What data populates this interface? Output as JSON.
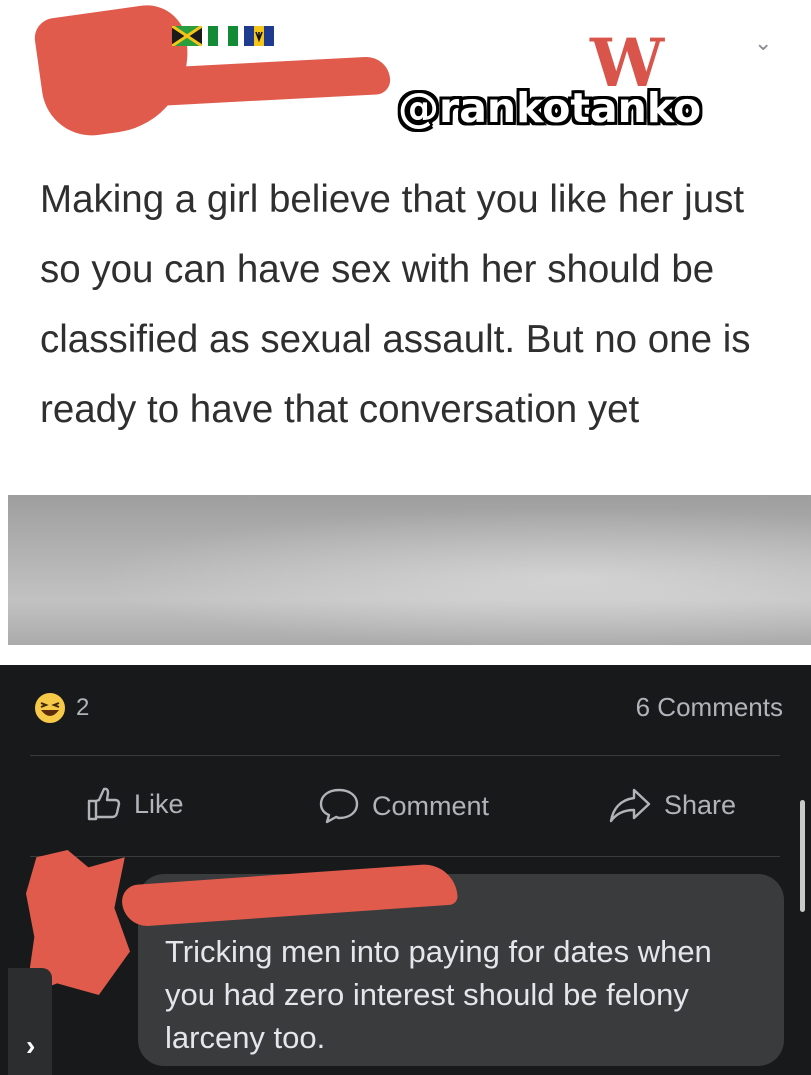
{
  "watermark": "@rankotanko",
  "logo_text": "W",
  "post": {
    "text": "Making a girl believe that you like her just so you can have sex with her should be classified as sexual assault. But no one is ready to have that conversation yet"
  },
  "reactions": {
    "emoji": "laughing-emoji-icon",
    "count": "2"
  },
  "comments_count": "6 Comments",
  "actions": {
    "like": "Like",
    "comment": "Comment",
    "share": "Share"
  },
  "comment": {
    "text": "Tricking men into paying for dates when you had zero interest should be felony larceny too."
  },
  "colors": {
    "redaction": "#e05b4c",
    "dark_background": "#18191a",
    "bubble": "#3a3b3c",
    "secondary_text": "#b0b3b8"
  }
}
